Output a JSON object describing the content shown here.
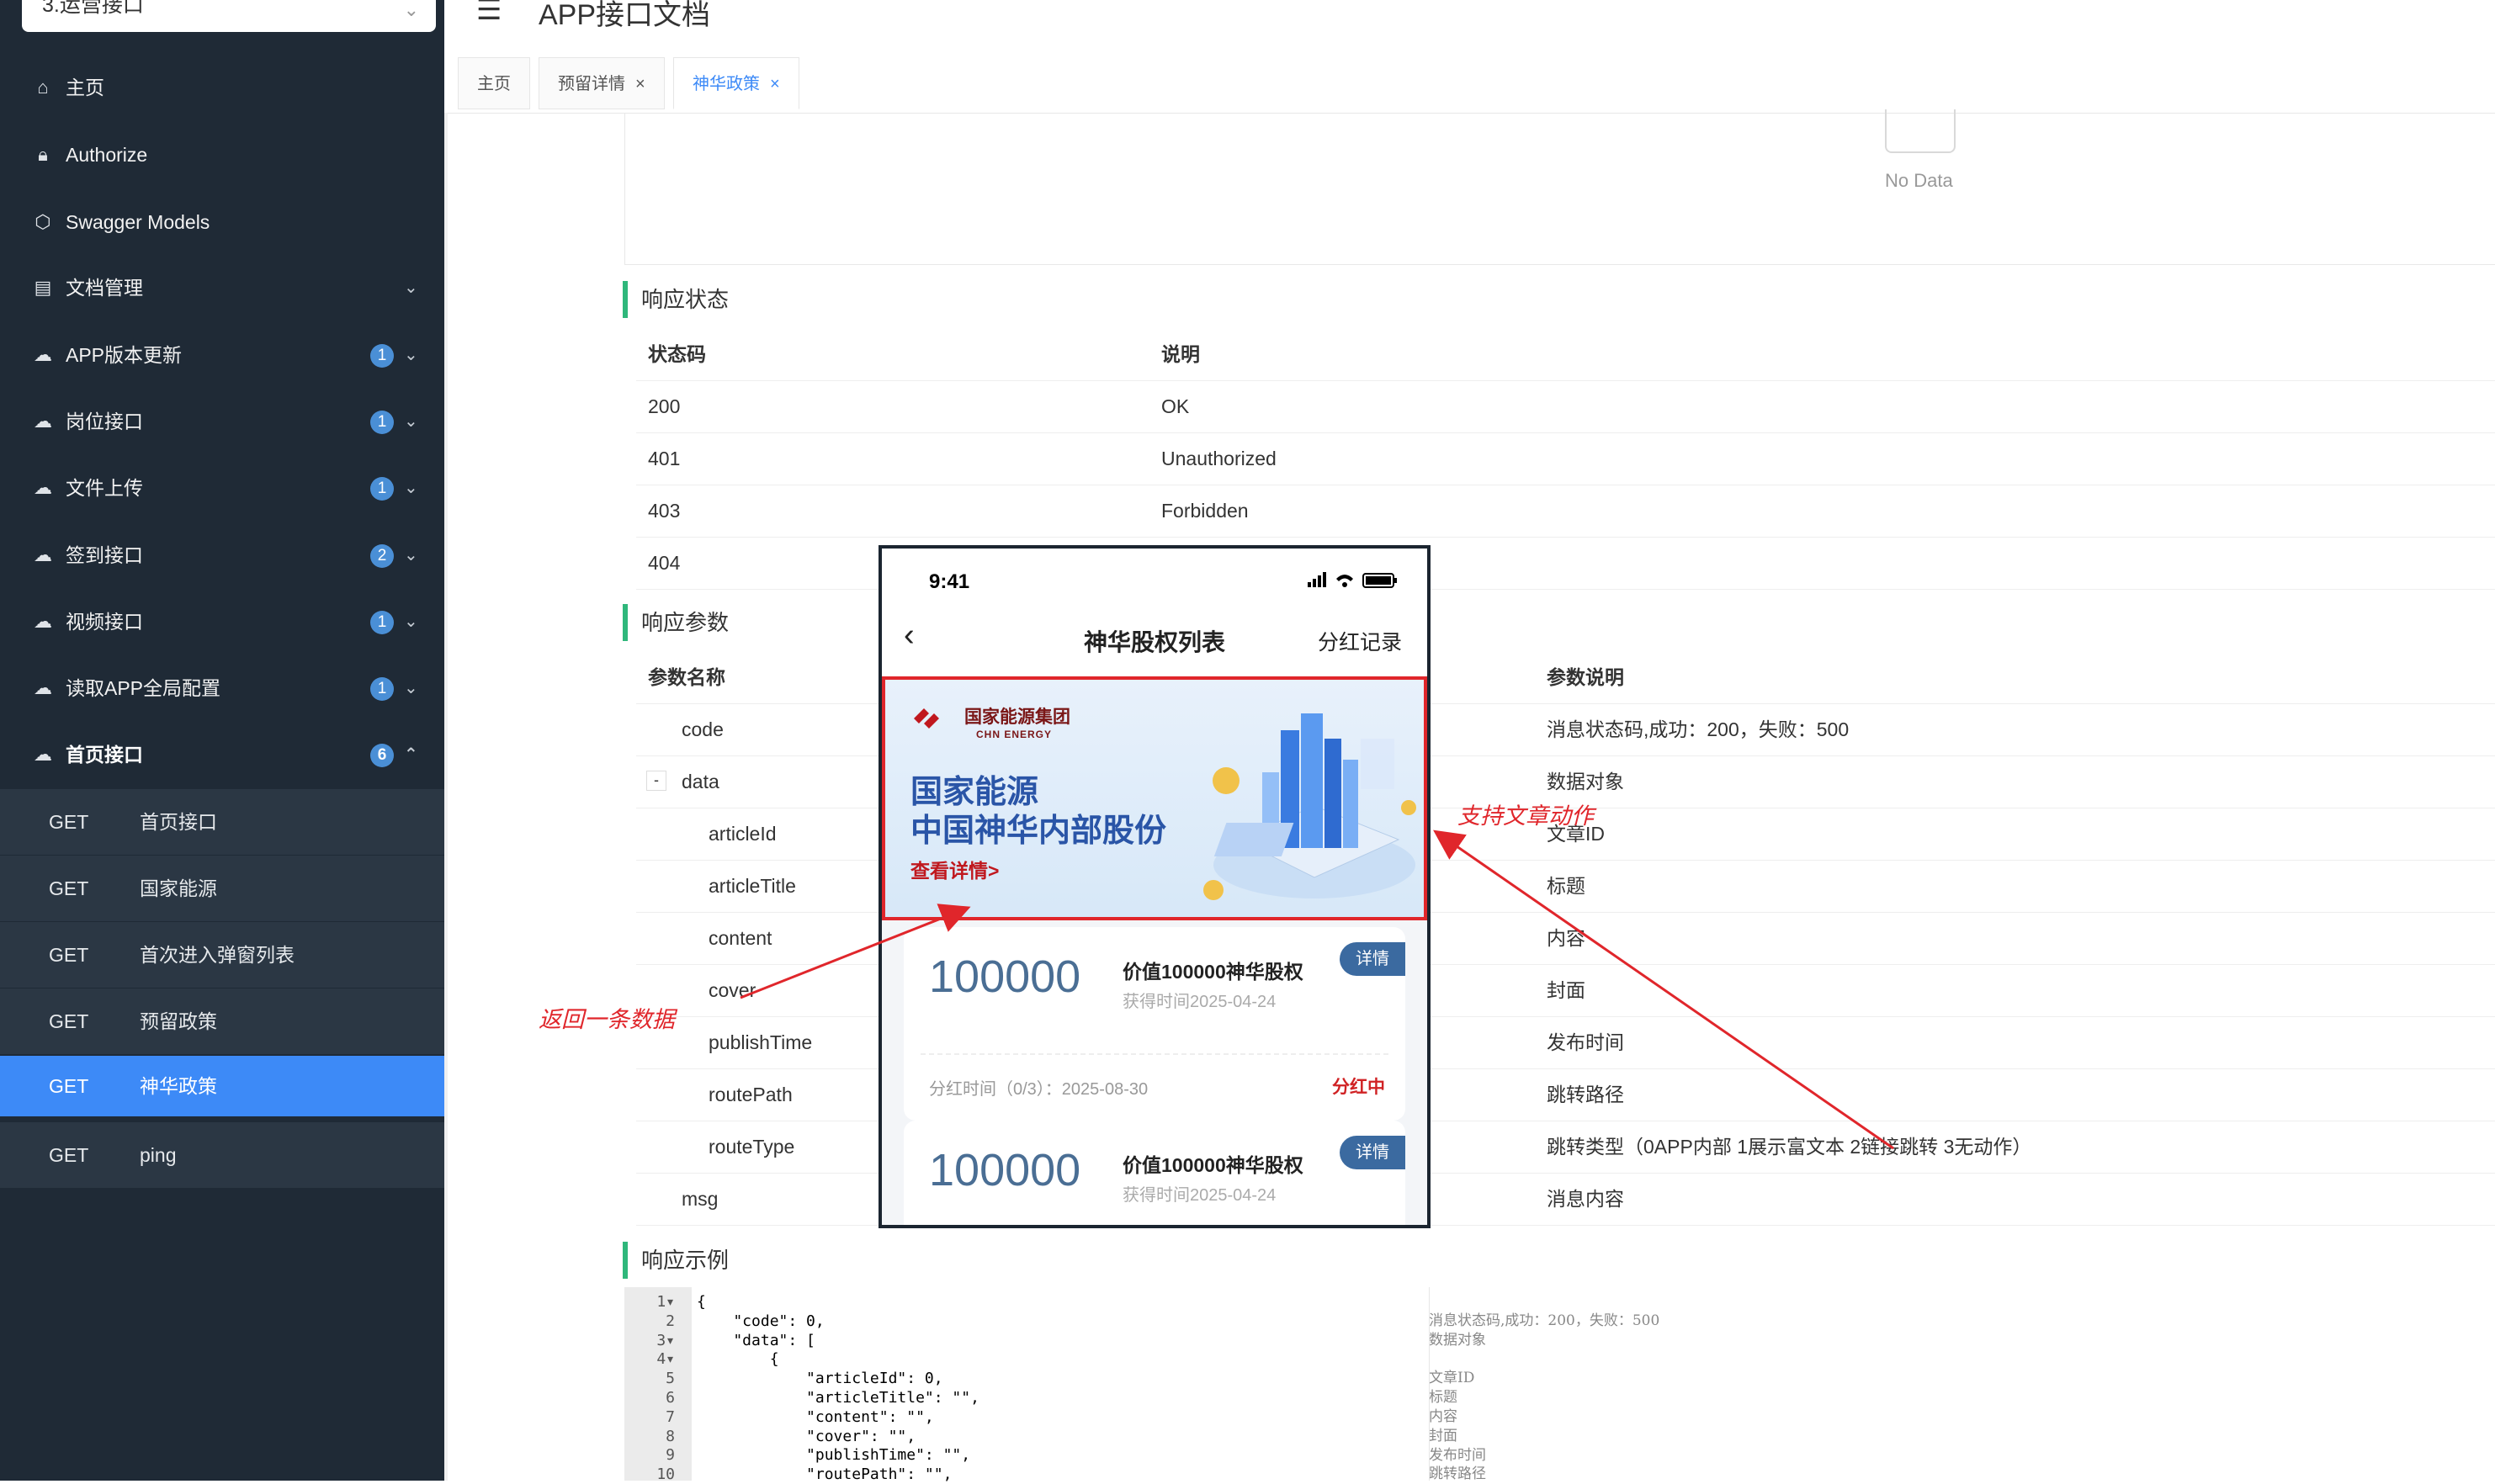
{
  "sidebar": {
    "group_select": "3.运营接口",
    "items": [
      {
        "label": "主页",
        "icon": "home-icon"
      },
      {
        "label": "Authorize",
        "icon": "lock-icon"
      },
      {
        "label": "Swagger Models",
        "icon": "cube-icon"
      },
      {
        "label": "文档管理",
        "icon": "doc-icon"
      },
      {
        "label": "APP版本更新",
        "badge": "1"
      },
      {
        "label": "岗位接口",
        "badge": "1"
      },
      {
        "label": "文件上传",
        "badge": "1"
      },
      {
        "label": "签到接口",
        "badge": "2"
      },
      {
        "label": "视频接口",
        "badge": "1"
      },
      {
        "label": "读取APP全局配置",
        "badge": "1"
      },
      {
        "label": "首页接口",
        "badge": "6"
      }
    ],
    "sub_items": [
      {
        "method": "GET",
        "label": "首页接口"
      },
      {
        "method": "GET",
        "label": "国家能源"
      },
      {
        "method": "GET",
        "label": "首次进入弹窗列表"
      },
      {
        "method": "GET",
        "label": "预留政策"
      },
      {
        "method": "GET",
        "label": "神华政策"
      },
      {
        "method": "GET",
        "label": "ping"
      }
    ]
  },
  "header": {
    "title": "APP接口文档"
  },
  "tabs": [
    {
      "label": "主页"
    },
    {
      "label": "预留详情",
      "close": "×"
    },
    {
      "label": "神华政策",
      "close": "×"
    }
  ],
  "no_data": "No Data",
  "response_status": {
    "title": "响应状态",
    "headers": [
      "状态码",
      "说明"
    ],
    "rows": [
      [
        "200",
        "OK"
      ],
      [
        "401",
        "Unauthorized"
      ],
      [
        "403",
        "Forbidden"
      ],
      [
        "404",
        ""
      ]
    ]
  },
  "response_params": {
    "title": "响应参数",
    "headers": [
      "参数名称",
      "参数说明"
    ],
    "rows": [
      {
        "name": "code",
        "desc": "消息状态码,成功：200，失败：500"
      },
      {
        "name": "data",
        "desc": "数据对象",
        "toggle": "-"
      },
      {
        "name": "articleId",
        "desc": "文章ID"
      },
      {
        "name": "articleTitle",
        "desc": "标题"
      },
      {
        "name": "content",
        "desc": "内容"
      },
      {
        "name": "cover",
        "desc": "封面"
      },
      {
        "name": "publishTime",
        "desc": "发布时间"
      },
      {
        "name": "routePath",
        "desc": "跳转路径"
      },
      {
        "name": "routeType",
        "desc": "跳转类型（0APP内部 1展示富文本 2链接跳转 3无动作）"
      },
      {
        "name": "msg",
        "desc": "消息内容"
      }
    ]
  },
  "response_example": {
    "title": "响应示例",
    "lines": [
      {
        "n": "1",
        "fold": "▾",
        "text": "{"
      },
      {
        "n": "2",
        "text": "    \"code\": 0,"
      },
      {
        "n": "3",
        "fold": "▾",
        "text": "    \"data\": ["
      },
      {
        "n": "4",
        "fold": "▾",
        "text": "        {"
      },
      {
        "n": "5",
        "text": "            \"articleId\": 0,"
      },
      {
        "n": "6",
        "text": "            \"articleTitle\": \"\","
      },
      {
        "n": "7",
        "text": "            \"content\": \"\","
      },
      {
        "n": "8",
        "text": "            \"cover\": \"\","
      },
      {
        "n": "9",
        "text": "            \"publishTime\": \"\","
      },
      {
        "n": "10",
        "text": "            \"routePath\": \"\","
      }
    ],
    "comments": [
      "消息状态码,成功：200，失败：500",
      "数据对象",
      "",
      "文章ID",
      "标题",
      "内容",
      "封面",
      "发布时间",
      "跳转路径"
    ]
  },
  "phone": {
    "time": "9:41",
    "title": "神华股权列表",
    "right": "分红记录",
    "banner": {
      "logo_cn": "国家能源集团",
      "logo_en": "CHN ENERGY",
      "line1": "国家能源",
      "line2": "中国神华内部股份",
      "link": "查看详情>"
    },
    "cards": [
      {
        "value": "100000",
        "name": "价值100000神华股权",
        "date": "获得时间2025-04-24",
        "tag": "详情",
        "dividend": "分红时间（0/3）：2025-08-30",
        "status": "分红中"
      },
      {
        "value": "100000",
        "name": "价值100000神华股权",
        "date": "获得时间2025-04-24",
        "tag": "详情"
      }
    ]
  },
  "annotations": {
    "left": "返回一条数据",
    "right": "支持文章动作",
    "color": "#e0262b"
  },
  "colors": {
    "sidebar": "#1f2a36",
    "active": "#3d8af7",
    "section_bar": "#2fb77b",
    "badge": "#4a8fd6"
  }
}
